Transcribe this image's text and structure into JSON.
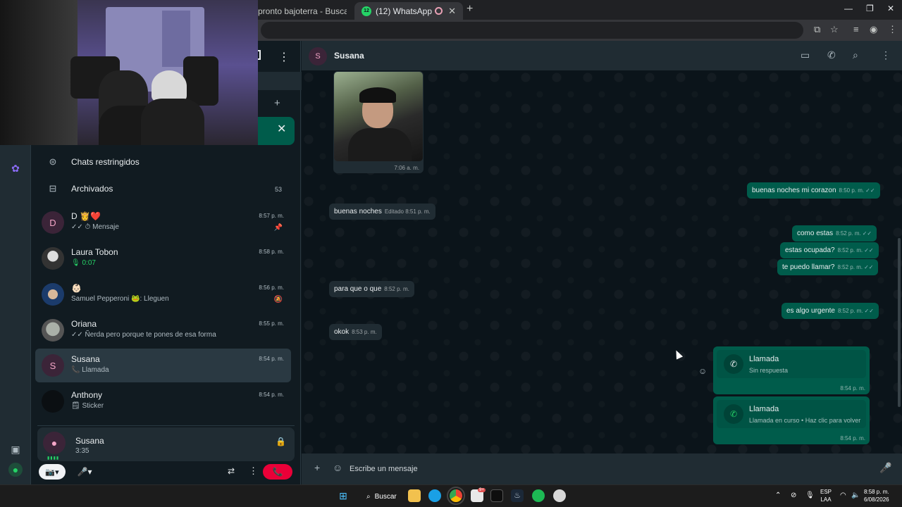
{
  "browser": {
    "tabs": [
      {
        "label": "pronto bajoterra - Buscar con G"
      },
      {
        "label": "(12) WhatsApp",
        "badge": "12"
      }
    ],
    "close_glyph": "✕",
    "new_tab_glyph": "+",
    "window_controls": {
      "minimize": "—",
      "restore": "❐",
      "close": "✕"
    }
  },
  "left_rail": {
    "icons": [
      "meta-ai-icon",
      "media-icon",
      "profile-icon"
    ]
  },
  "chat_list": {
    "restricted_label": "Chats restringidos",
    "archived_label": "Archivados",
    "archived_count": "53",
    "chats": [
      {
        "avatar_letter": "D",
        "name": "D 👸❤️",
        "preview": "✓✓ ⏱ Mensaje",
        "time": "8:57 p. m.",
        "flag": "📌"
      },
      {
        "avatar_letter": "",
        "name": "Laura Tobon",
        "preview_icon": "🎙",
        "preview": "0:07",
        "time": "8:58 p. m."
      },
      {
        "avatar_letter": "",
        "name": "👶🏻",
        "preview": "Samuel Pepperoni 🐸: Lleguen",
        "time": "8:56 p. m.",
        "flag": "🔕"
      },
      {
        "avatar_letter": "",
        "name": "Oriana",
        "preview": "✓✓ Ñerda pero porque te pones de esa forma",
        "time": "8:55 p. m."
      },
      {
        "avatar_letter": "S",
        "name": "Susana",
        "preview_icon": "📞",
        "preview": "Llamada",
        "time": "8:54 p. m."
      },
      {
        "avatar_letter": "",
        "name": "Anthony",
        "preview": "🗒 Sticker",
        "time": "8:54 p. m."
      }
    ]
  },
  "call_bar": {
    "name": "Susana",
    "duration": "3:35",
    "lock_glyph": "🔒",
    "camera_off_glyph": "📷",
    "mic_glyph": "🎤",
    "share_glyph": "⇄",
    "more_glyph": "⋮",
    "hangup_glyph": "📞"
  },
  "conversation": {
    "contact_letter": "S",
    "contact_name": "Susana",
    "header_icons": {
      "video": "▭",
      "call": "✆",
      "search": "⌕",
      "more": "⋮"
    },
    "image_time": "7:06 a. m.",
    "messages": [
      {
        "dir": "out",
        "text": "buenas noches mi corazon",
        "time": "8:50 p. m.",
        "ticks": "✓✓"
      },
      {
        "dir": "in",
        "text": "buenas noches",
        "time": "Editado 8:51 p. m."
      },
      {
        "dir": "out",
        "text": "como estas",
        "time": "8:52 p. m.",
        "ticks": "✓✓"
      },
      {
        "dir": "out",
        "text": "estas ocupada?",
        "time": "8:52 p. m.",
        "ticks": "✓✓"
      },
      {
        "dir": "out",
        "text": "te puedo llamar?",
        "time": "8:52 p. m.",
        "ticks": "✓✓"
      },
      {
        "dir": "in",
        "text": "para que o que",
        "time": "8:52 p. m."
      },
      {
        "dir": "out",
        "text": "es algo urgente",
        "time": "8:52 p. m.",
        "ticks": "✓✓"
      },
      {
        "dir": "in",
        "text": "okok",
        "time": "8:53 p. m."
      }
    ],
    "call_cards": [
      {
        "title": "Llamada",
        "subtitle": "Sin respuesta",
        "time": "8:54 p. m.",
        "icon": "✆"
      },
      {
        "title": "Llamada",
        "subtitle": "Llamada en curso • Haz clic para volver",
        "time": "8:54 p. m.",
        "icon": "✆"
      }
    ],
    "reaction_glyph": "☺",
    "composer_placeholder": "Escribe un mensaje",
    "composer_plus": "+",
    "composer_emoji": "☺",
    "composer_mic": "🎤"
  },
  "taskbar": {
    "search_label": "Buscar",
    "badge_count": "9+",
    "language": "ESP",
    "layout": "LAA",
    "time": "8:58 p. m.",
    "date": "6/08/2026"
  }
}
